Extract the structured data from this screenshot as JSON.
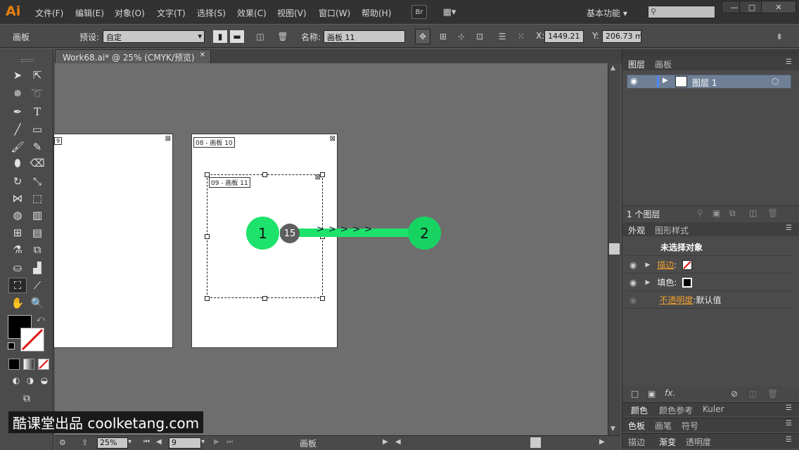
{
  "app": {
    "logo": "Ai",
    "workspace": "基本功能 ▾",
    "bridge": "Br"
  },
  "menu": [
    "文件(F)",
    "编辑(E)",
    "对象(O)",
    "文字(T)",
    "选择(S)",
    "效果(C)",
    "视图(V)",
    "窗口(W)",
    "帮助(H)"
  ],
  "window_controls": {
    "minimize": "—",
    "maximize": "□",
    "close": "✕"
  },
  "control_bar": {
    "section": "画板",
    "preset_label": "预设:",
    "preset_value": "自定",
    "name_label": "名称:",
    "name_value": "画板 11",
    "x_label": "X:",
    "x_value": "1449.21 r",
    "y_label": "Y:",
    "y_value": "206.73 mm"
  },
  "document_tab": {
    "title": "Work68.ai* @ 25% (CMYK/预览)",
    "close": "✕"
  },
  "artboards": [
    {
      "label": "9"
    },
    {
      "label": "08 - 画板 10"
    },
    {
      "label": "09 - 画板 11"
    }
  ],
  "annotation": {
    "start": "1",
    "end": "2",
    "badge": "15",
    "arrows": "> > > > >"
  },
  "status": {
    "zoom": "25%",
    "page": "9",
    "tool_name": "画板"
  },
  "layers_panel": {
    "tabs": [
      "图层",
      "画板"
    ],
    "layer_name": "图层 1",
    "count": "1 个图层"
  },
  "appearance_panel": {
    "tabs": [
      "外观",
      "图形样式"
    ],
    "header": "未选择对象",
    "stroke_label": "描边",
    "fill_label": "填色:",
    "opacity_label": "不透明度",
    "opacity_value": "默认值"
  },
  "color_panel": {
    "tabs": [
      "颜色",
      "颜色参考",
      "Kuler"
    ]
  },
  "swatches_panel": {
    "tabs": [
      "色板",
      "画笔",
      "符号"
    ]
  },
  "stroke_panel": {
    "tabs": [
      "描边",
      "渐变",
      "透明度"
    ]
  },
  "watermark": "酷课堂出品 coolketang.com",
  "colors": {
    "accent_green": "#1de26b",
    "orange_logo": "#e8820f"
  }
}
